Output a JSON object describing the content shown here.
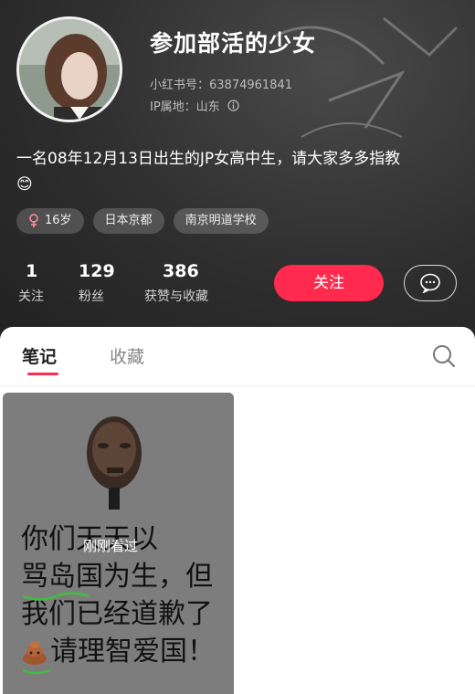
{
  "profile": {
    "name": "参加部活的少女",
    "id_line": "小红书号：63874961841",
    "ip_line": "IP属地：山东",
    "bio": "一名08年12月13日出生的JP女高中生，请大家多多指教",
    "bio_emoji": "😊"
  },
  "tags": [
    {
      "label": "16岁",
      "icon": "female-icon"
    },
    {
      "label": "日本京都"
    },
    {
      "label": "南京明道学校"
    }
  ],
  "stats": [
    {
      "value": "1",
      "label": "关注"
    },
    {
      "value": "129",
      "label": "粉丝"
    },
    {
      "value": "386",
      "label": "获赞与收藏"
    }
  ],
  "actions": {
    "follow": "关注",
    "message_icon": "chat-icon"
  },
  "tabs": {
    "notes": "笔记",
    "favorites": "收藏",
    "search_icon": "search-icon"
  },
  "note_card": {
    "lines": [
      "你们天天以",
      "骂岛国为生，但",
      "我们已经道歉了",
      "请理智爱国！"
    ],
    "overlay": "刚刚看过"
  },
  "colors": {
    "accent": "#ff2a4d"
  }
}
